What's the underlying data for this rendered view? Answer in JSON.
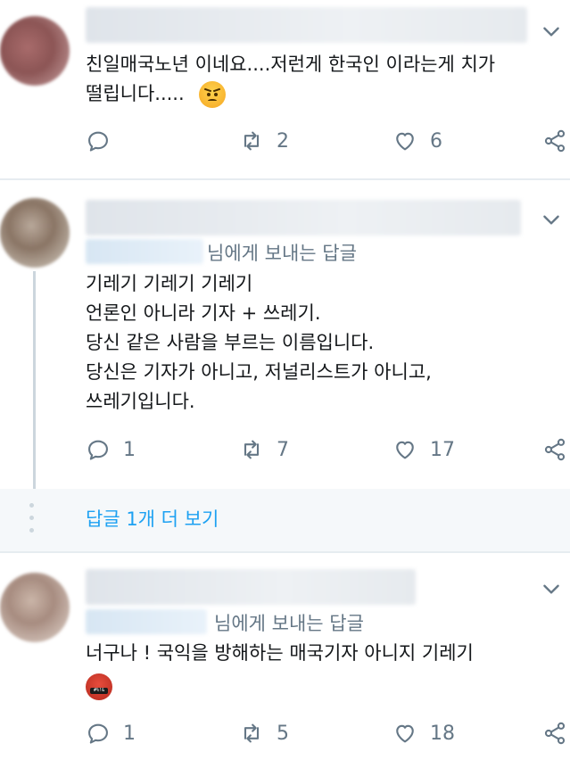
{
  "colors": {
    "accent": "#1da1f2",
    "muted": "#657786",
    "text": "#14171a",
    "divider": "#e6ecf0"
  },
  "tweets": [
    {
      "text_lines": [
        "친일매국노년 이네요....저런게 한국인 이라는게 치가",
        "떨립니다....."
      ],
      "emoji": "pouting-face",
      "replies": "",
      "retweets": "2",
      "likes": "6"
    },
    {
      "reply_to_suffix": "님에게 보내는 답글",
      "text_lines": [
        "기레기 기레기 기레기",
        "언론인 아니라 기자 + 쓰레기.",
        "당신 같은 사람을 부르는 이름입니다.",
        "당신은 기자가 아니고, 저널리스트가 아니고,",
        "쓰레기입니다."
      ],
      "replies": "1",
      "retweets": "7",
      "likes": "17"
    },
    {
      "reply_to_suffix": "님에게 보내는 답글",
      "text_lines": [
        "너구나 ! 국익을 방해하는 매국기자 아니지 기레기"
      ],
      "emoji": "face-with-symbols-on-mouth",
      "emoji_label": "#%!&",
      "replies": "1",
      "retweets": "5",
      "likes": "18"
    }
  ],
  "more_replies": {
    "label": "답글 1개 더 보기"
  },
  "icons": [
    "reply-icon",
    "retweet-icon",
    "like-icon",
    "share-icon",
    "chevron-down-icon"
  ]
}
